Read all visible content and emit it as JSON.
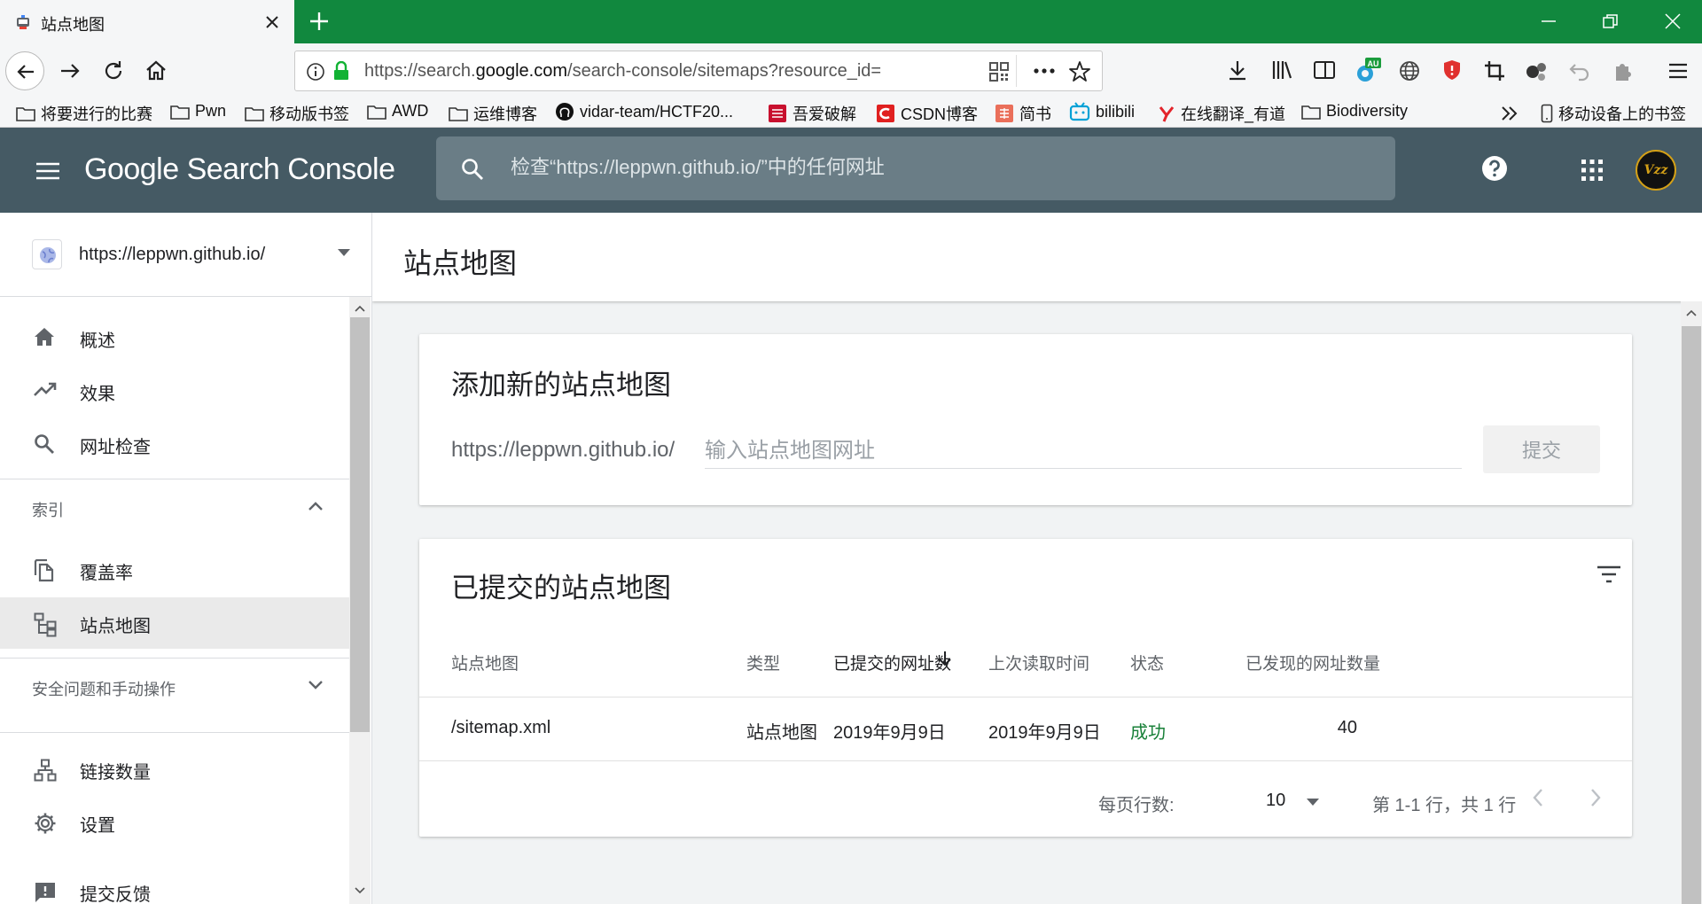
{
  "browser": {
    "tab_title": "站点地图",
    "url_prefix": "https://search.",
    "url_domain": "google.com",
    "url_path": "/search-console/sitemaps?resource_id=",
    "extension_badge": "AU",
    "bookmarks": [
      {
        "label": "将要进行的比赛",
        "icon": "folder-icon"
      },
      {
        "label": "Pwn",
        "icon": "folder-icon"
      },
      {
        "label": "移动版书签",
        "icon": "folder-icon"
      },
      {
        "label": "AWD",
        "icon": "folder-icon"
      },
      {
        "label": "运维博客",
        "icon": "folder-icon"
      },
      {
        "label": "vidar-team/HCTF20...",
        "icon": "github-icon"
      },
      {
        "label": "吾爱破解",
        "icon": "52pojie-icon"
      },
      {
        "label": "CSDN博客",
        "icon": "csdn-icon"
      },
      {
        "label": "简书",
        "icon": "jianshu-icon"
      },
      {
        "label": "bilibili",
        "icon": "bilibili-icon"
      },
      {
        "label": "在线翻译_有道",
        "icon": "youdao-icon"
      },
      {
        "label": "Biodiversity",
        "icon": "folder-icon"
      }
    ],
    "mobile_bookmarks": "移动设备上的书签"
  },
  "gsc": {
    "logo_google": "Google",
    "logo_product": "Search Console",
    "search_placeholder": "检查“https://leppwn.github.io/”中的任何网址",
    "avatar_text": "Vzz"
  },
  "sidebar": {
    "property_url": "https://leppwn.github.io/",
    "items_top": [
      {
        "label": "概述",
        "icon": "home-icon"
      },
      {
        "label": "效果",
        "icon": "trending-up-icon"
      },
      {
        "label": "网址检查",
        "icon": "search-icon"
      }
    ],
    "section_index": "索引",
    "items_index": [
      {
        "label": "覆盖率",
        "icon": "file-copy-icon"
      },
      {
        "label": "站点地图",
        "icon": "sitemap-icon",
        "active": true
      }
    ],
    "section_security": "安全问题和手动操作",
    "items_bottom": [
      {
        "label": "链接数量",
        "icon": "links-icon"
      },
      {
        "label": "设置",
        "icon": "gear-icon"
      },
      {
        "label": "提交反馈",
        "icon": "feedback-icon"
      }
    ]
  },
  "main": {
    "page_title": "站点地图",
    "add_card": {
      "title": "添加新的站点地图",
      "prefix": "https://leppwn.github.io/",
      "input_placeholder": "输入站点地图网址",
      "submit_label": "提交"
    },
    "submitted_card": {
      "title": "已提交的站点地图",
      "columns": [
        "站点地图",
        "类型",
        "已提交的网址数",
        "上次读取时间",
        "状态",
        "已发现的网址数量"
      ],
      "rows": [
        {
          "sitemap": "/sitemap.xml",
          "type": "站点地图",
          "submitted": "2019年9月9日",
          "last_read": "2019年9月9日",
          "status": "成功",
          "discovered": "40"
        }
      ],
      "rows_per_page_label": "每页行数:",
      "rows_per_page_value": "10",
      "range_label": "第 1-1 行，共 1 行"
    }
  },
  "colors": {
    "tabbar": "#11883e",
    "gsc_header": "#455a64",
    "status_success": "#188038"
  }
}
